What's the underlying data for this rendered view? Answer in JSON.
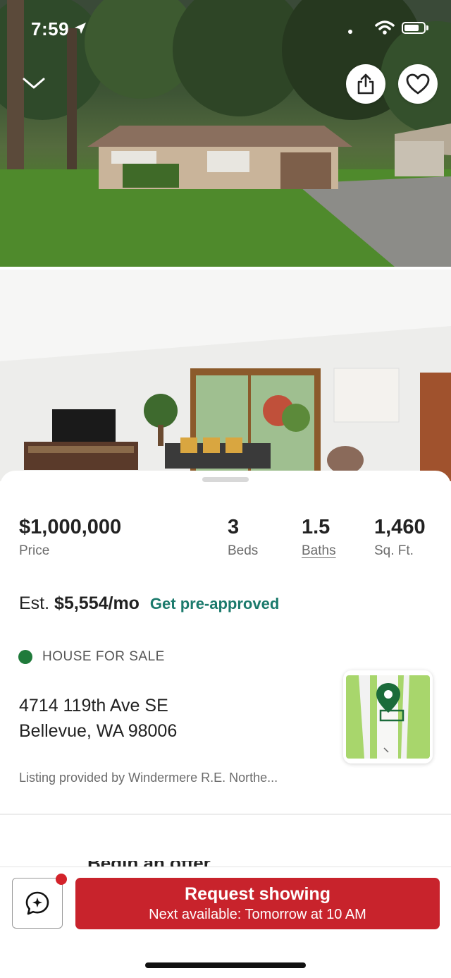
{
  "status_bar": {
    "time": "7:59"
  },
  "header": {
    "collapse_icon": "chevron-down-icon",
    "share_icon": "share-icon",
    "favorite_icon": "heart-icon"
  },
  "listing": {
    "price": "$1,000,000",
    "price_label": "Price",
    "beds": "3",
    "beds_label": "Beds",
    "baths": "1.5",
    "baths_label": "Baths",
    "sqft": "1,460",
    "sqft_label": "Sq. Ft.",
    "est_prefix": "Est.",
    "est_payment": "$5,554/mo",
    "preapproved_link": "Get pre-approved",
    "status": "HOUSE FOR SALE",
    "status_color": "#1f7a3a",
    "address_line1": "4714 119th Ave SE",
    "address_line2": "Bellevue, WA 98006",
    "provider": "Listing provided by Windermere R.E. Northe..."
  },
  "bottom_bar": {
    "request_title": "Request showing",
    "request_subtitle": "Next available: Tomorrow at 10 AM",
    "accent_color": "#c8232c"
  }
}
